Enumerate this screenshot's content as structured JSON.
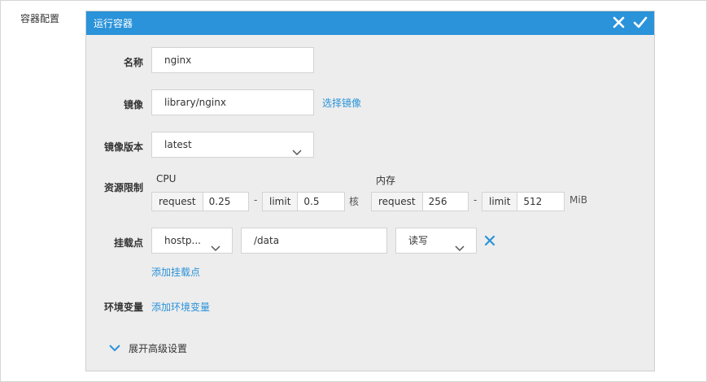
{
  "section": {
    "label": "容器配置"
  },
  "panel": {
    "title": "运行容器",
    "close_icon": "close-icon",
    "confirm_icon": "check-icon",
    "accent": "#2a93d9"
  },
  "form": {
    "name": {
      "label": "名称",
      "value": "nginx"
    },
    "image": {
      "label": "镜像",
      "value": "library/nginx",
      "select_link": "选择镜像"
    },
    "version": {
      "label": "镜像版本",
      "value": "latest"
    },
    "resources": {
      "label": "资源限制",
      "cpu": {
        "caption": "CPU",
        "request_label": "request",
        "request_value": "0.25",
        "dash": "-",
        "limit_label": "limit",
        "limit_value": "0.5",
        "unit": "核"
      },
      "memory": {
        "caption": "内存",
        "request_label": "request",
        "request_value": "256",
        "dash": "-",
        "limit_label": "limit",
        "limit_value": "512",
        "unit": "MiB"
      }
    },
    "mounts": {
      "label": "挂载点",
      "type_value": "hostp...",
      "path_value": "/data",
      "mode_value": "读写",
      "add_link": "添加挂载点"
    },
    "env": {
      "label": "环境变量",
      "add_link": "添加环境变量"
    },
    "advanced": {
      "label": "展开高级设置"
    }
  }
}
